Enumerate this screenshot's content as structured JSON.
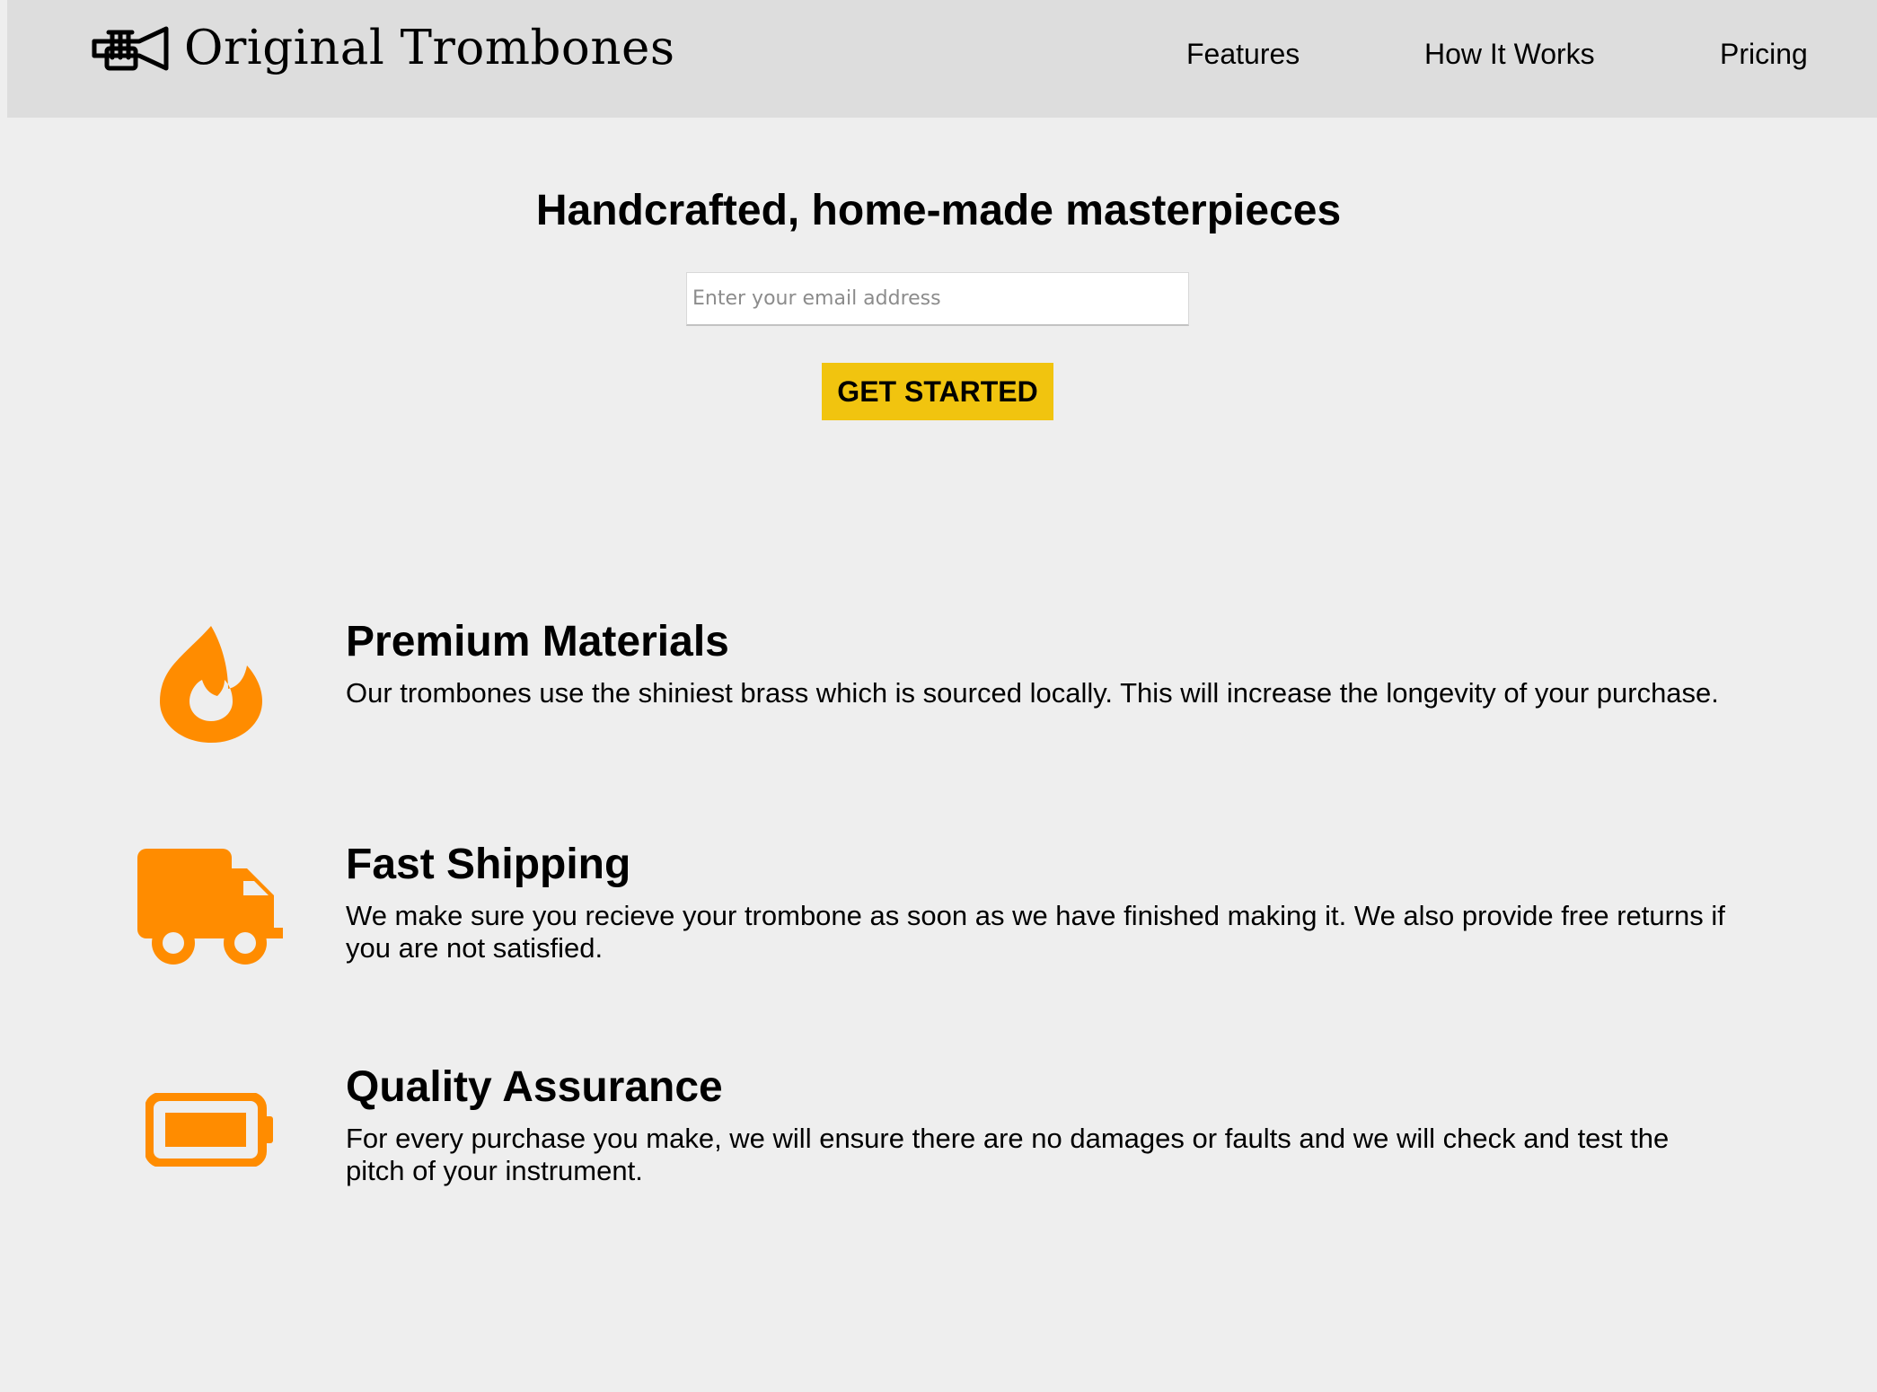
{
  "header": {
    "logo_text": "Original Trombones",
    "logo_icon": "trumpet-icon",
    "nav": [
      {
        "label": "Features"
      },
      {
        "label": "How It Works"
      },
      {
        "label": "Pricing"
      }
    ]
  },
  "hero": {
    "title": "Handcrafted, home-made masterpieces",
    "email_placeholder": "Enter your email address",
    "button_label": "GET STARTED"
  },
  "features": [
    {
      "icon": "fire-icon",
      "title": "Premium Materials",
      "description": "Our trombones use the shiniest brass which is sourced locally. This will increase the longevity of your purchase."
    },
    {
      "icon": "truck-icon",
      "title": "Fast Shipping",
      "description": "We make sure you recieve your trombone as soon as we have finished making it. We also provide free returns if you are not satisfied."
    },
    {
      "icon": "battery-icon",
      "title": "Quality Assurance",
      "description": "For every purchase you make, we will ensure there are no damages or faults and we will check and test the pitch of your instrument."
    }
  ],
  "colors": {
    "page_background": "#eeeeee",
    "header_background": "#dddddd",
    "accent_orange": "#ff8c00",
    "button_yellow": "#f1c40f"
  }
}
